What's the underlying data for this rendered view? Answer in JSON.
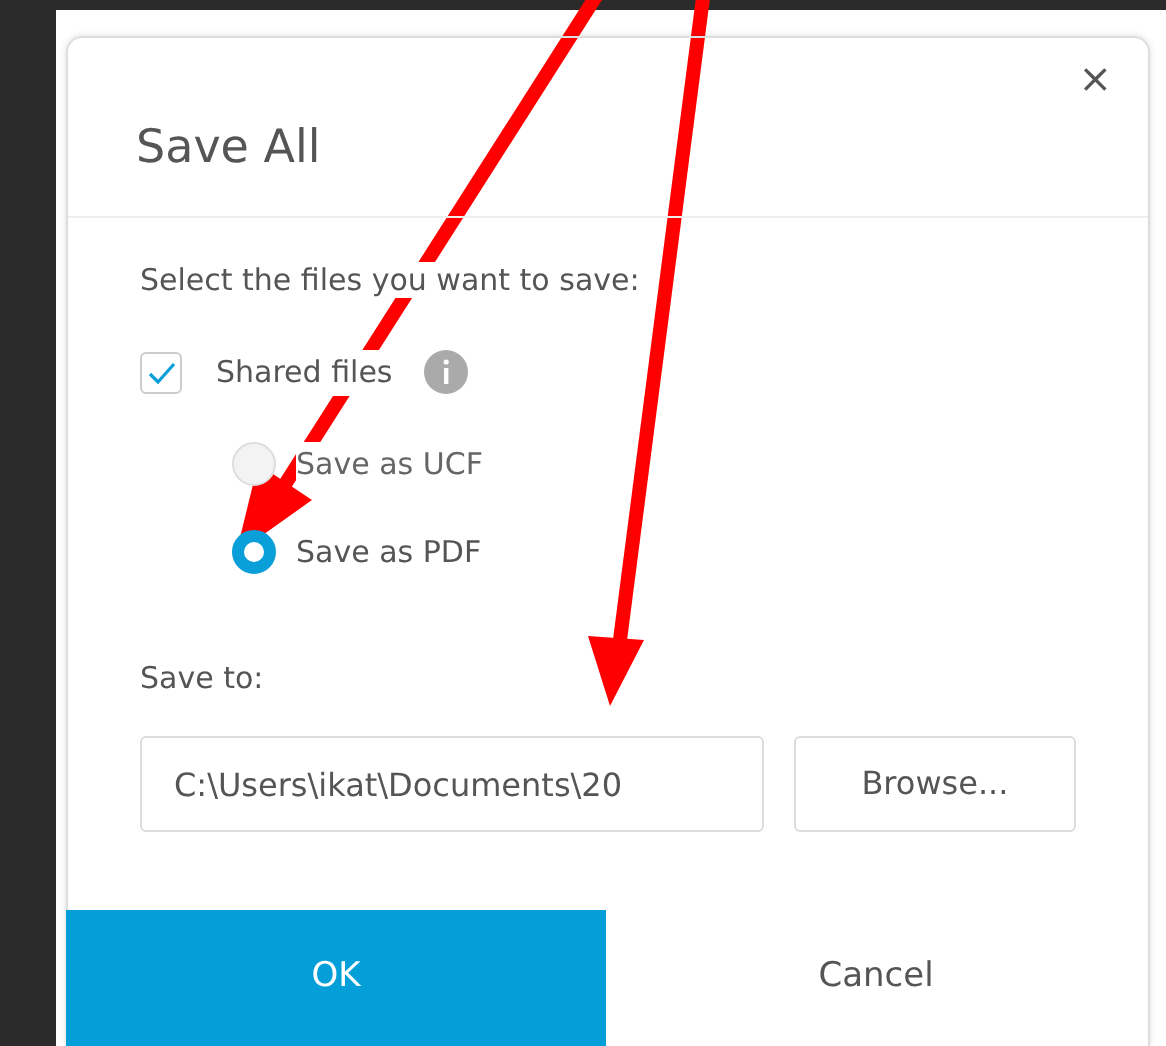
{
  "dialog": {
    "title": "Save All",
    "close": "×",
    "prompt": "Select the files you want to save:",
    "shared_files": {
      "label": "Shared files",
      "checked": true
    },
    "formats": [
      {
        "label": "Save as UCF",
        "selected": false,
        "disabled": true
      },
      {
        "label": "Save as PDF",
        "selected": true,
        "disabled": false
      }
    ],
    "save_to": {
      "label": "Save to:",
      "value": "C:\\Users\\ikat\\Documents\\20",
      "browse": "Browse..."
    },
    "buttons": [
      {
        "label": "OK",
        "kind": "primary"
      },
      {
        "label": "Cancel",
        "kind": "secondary"
      }
    ]
  }
}
